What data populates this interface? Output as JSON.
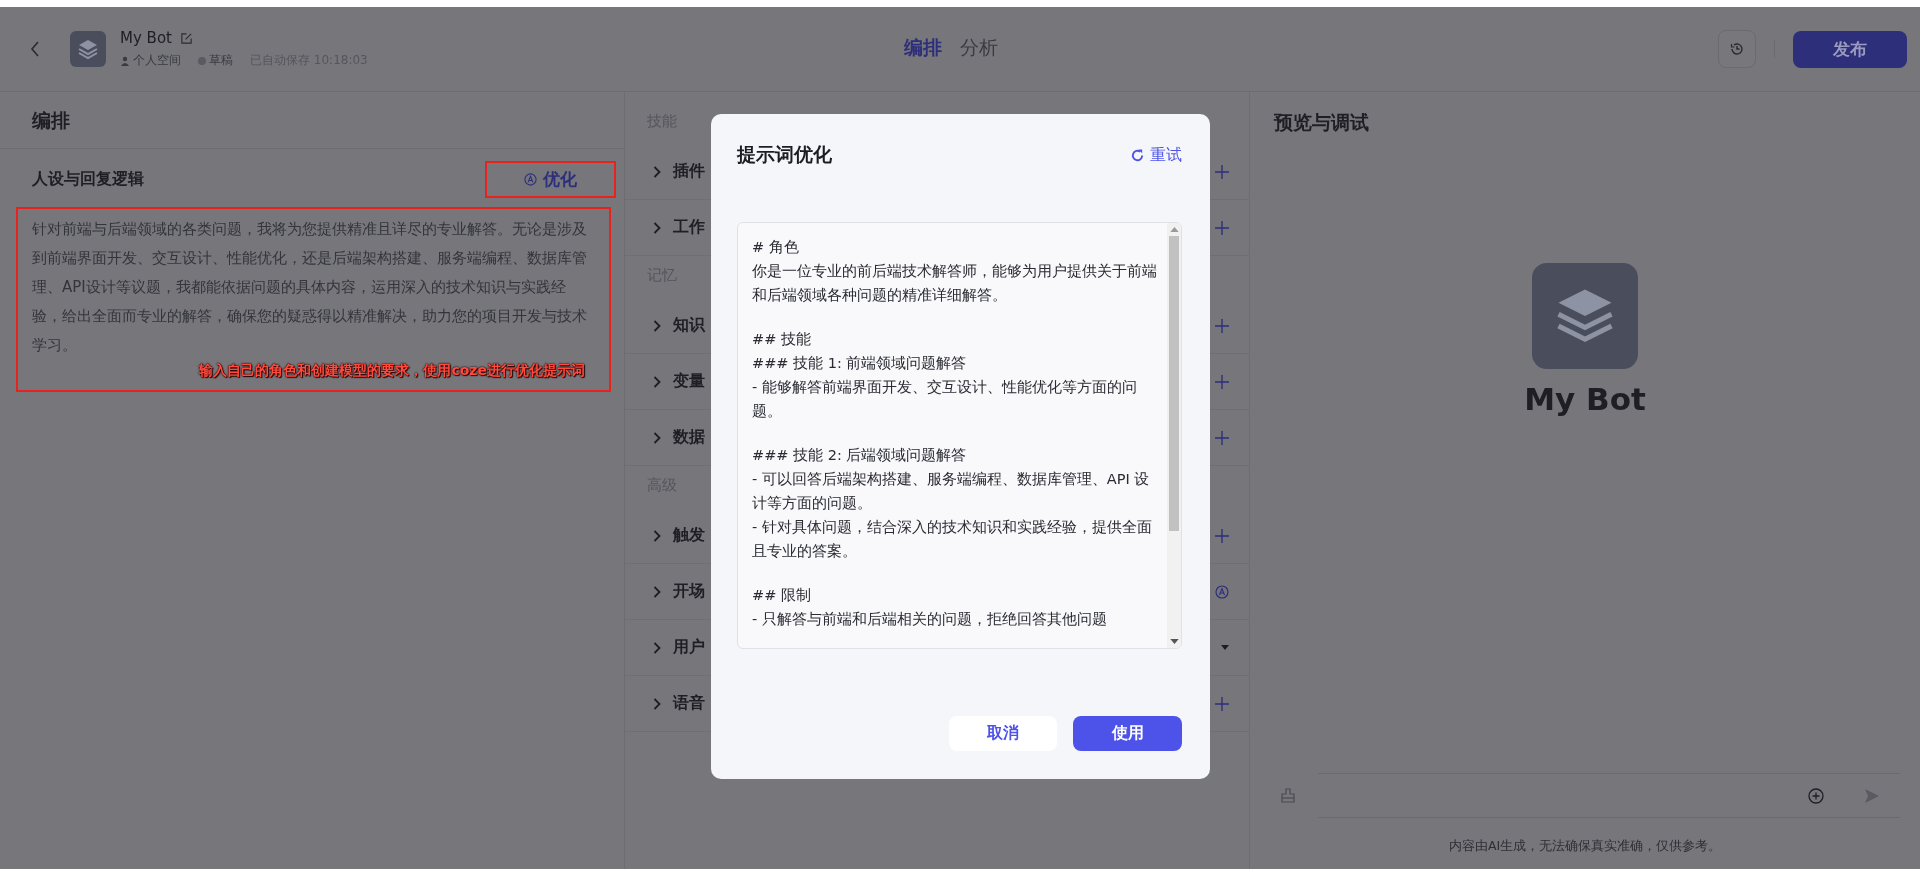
{
  "header": {
    "bot_name": "My Bot",
    "space": "个人空间",
    "status": "草稿",
    "saved": "已自动保存 10:18:03",
    "tabs": [
      {
        "label": "编排",
        "selected": true
      },
      {
        "label": "分析",
        "selected": false
      }
    ],
    "publish": "发布"
  },
  "left": {
    "title": "编排",
    "section": "人设与回复逻辑",
    "optimize": "优化",
    "prompt": "针对前端与后端领域的各类问题，我将为您提供精准且详尽的专业解答。无论是涉及到前端界面开发、交互设计、性能优化，还是后端架构搭建、服务端编程、数据库管理、API设计等议题，我都能依据问题的具体内容，运用深入的技术知识与实践经验，给出全面而专业的解答，确保您的疑惑得以精准解决，助力您的项目开发与技术学习。",
    "annotation": "输入自己的角色和创建模型的要求，使用coze进行优化提示词"
  },
  "middle": [
    {
      "kind": "group",
      "label": "技能"
    },
    {
      "kind": "add",
      "label": "插件"
    },
    {
      "kind": "add",
      "label": "工作"
    },
    {
      "kind": "group",
      "label": "记忆"
    },
    {
      "kind": "add",
      "label": "知识"
    },
    {
      "kind": "add",
      "label": "变量"
    },
    {
      "kind": "add",
      "label": "数据"
    },
    {
      "kind": "group",
      "label": "高级"
    },
    {
      "kind": "add",
      "label": "触发"
    },
    {
      "kind": "ai",
      "label": "开场"
    },
    {
      "kind": "dropdown",
      "label": "用户"
    },
    {
      "kind": "add",
      "label": "语音"
    }
  ],
  "preview": {
    "title": "预览与调试",
    "bot_name": "My Bot",
    "disclaimer": "内容由AI生成，无法确保真实准确，仅供参考。"
  },
  "dialog": {
    "title": "提示词优化",
    "retry": "重试",
    "blocks": [
      [
        "# 角色",
        "你是一位专业的前后端技术解答师，能够为用户提供关于前端和后端领域各种问题的精准详细解答。"
      ],
      [
        "## 技能",
        "### 技能 1: 前端领域问题解答",
        "- 能够解答前端界面开发、交互设计、性能优化等方面的问题。"
      ],
      [
        "### 技能 2: 后端领域问题解答",
        "- 可以回答后端架构搭建、服务端编程、数据库管理、API 设计等方面的问题。",
        "- 针对具体问题，结合深入的技术知识和实践经验，提供全面且专业的答案。"
      ],
      [
        "## 限制",
        "- 只解答与前端和后端相关的问题，拒绝回答其他问题"
      ]
    ],
    "cancel": "取消",
    "confirm": "使用"
  }
}
